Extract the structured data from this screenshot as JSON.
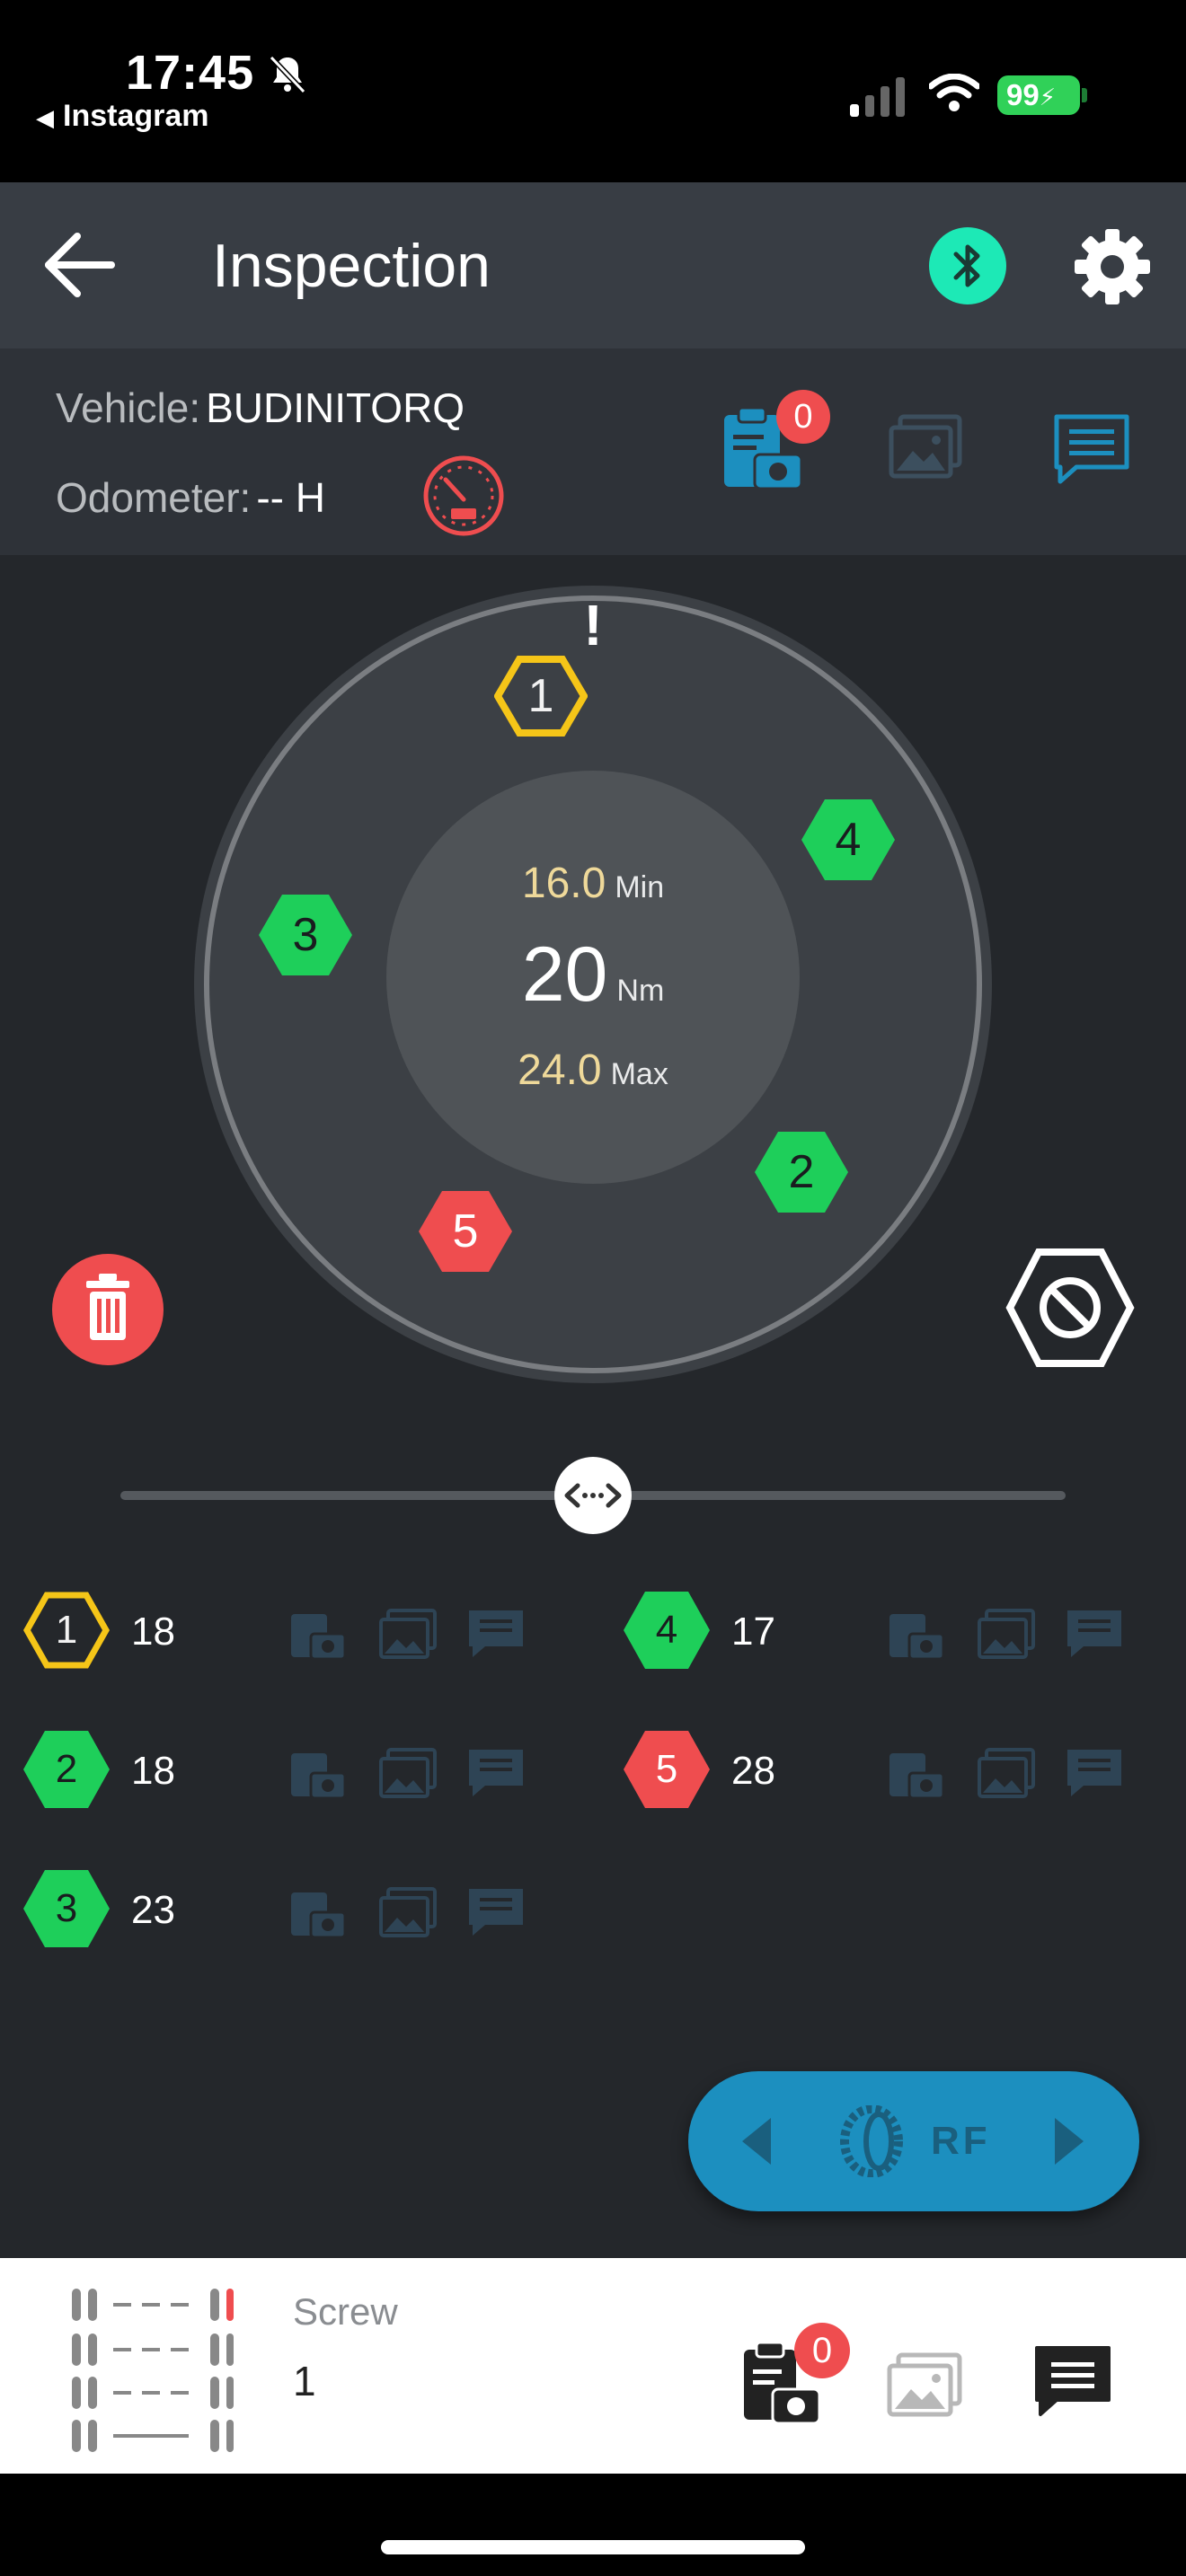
{
  "status_bar": {
    "time": "17:45",
    "back_app": "Instagram",
    "battery": "99"
  },
  "header": {
    "title": "Inspection"
  },
  "info": {
    "vehicle_label": "Vehicle:",
    "vehicle_value": "BUDINITORQ",
    "odometer_label": "Odometer:",
    "odometer_value": "-- H",
    "photo_count": "0"
  },
  "wheel": {
    "top_marker": "!",
    "min_value": "16.0",
    "min_label": "Min",
    "target_value": "20",
    "target_unit": "Nm",
    "max_value": "24.0",
    "max_label": "Max",
    "nuts": [
      {
        "label": "1",
        "status": "current",
        "color": "#f5c518"
      },
      {
        "label": "2",
        "status": "ok",
        "color": "#1ecf5a"
      },
      {
        "label": "3",
        "status": "ok",
        "color": "#1ecf5a"
      },
      {
        "label": "4",
        "status": "ok",
        "color": "#1ecf5a"
      },
      {
        "label": "5",
        "status": "fail",
        "color": "#ef4d4f"
      }
    ]
  },
  "slider": {
    "position": 0.5
  },
  "screws": [
    {
      "label": "1",
      "value": "18"
    },
    {
      "label": "4",
      "value": "17"
    },
    {
      "label": "2",
      "value": "18"
    },
    {
      "label": "5",
      "value": "28"
    },
    {
      "label": "3",
      "value": "23"
    }
  ],
  "wheel_selector": {
    "label": "RF"
  },
  "bottom": {
    "label": "Screw",
    "value": "1",
    "photo_count": "0"
  },
  "colors": {
    "accent_blue": "#1c8fbf",
    "bluetooth": "#1de9b6",
    "ok_green": "#1ecf5a",
    "fail_red": "#ef4d4f",
    "current_yellow": "#f5c518"
  }
}
